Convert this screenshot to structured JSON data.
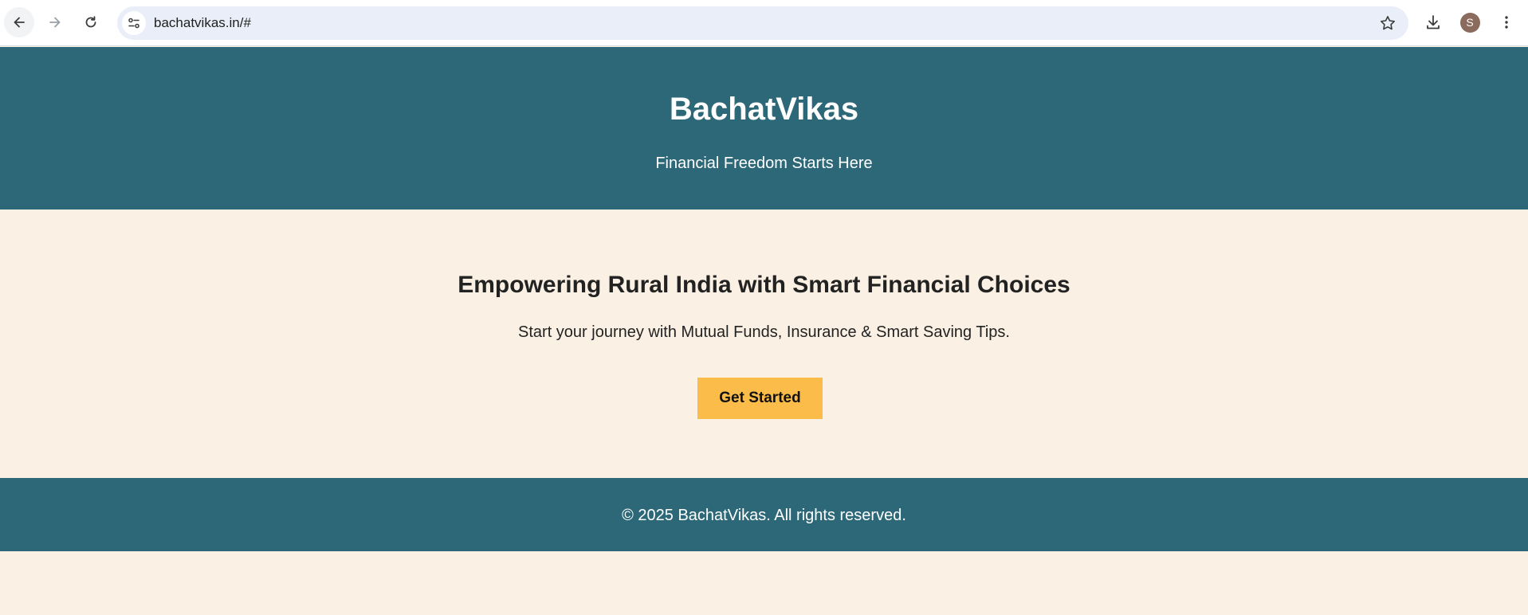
{
  "browser": {
    "url": "bachatvikas.in/#",
    "profile_initial": "S",
    "icons": {
      "back": "arrow-left-icon",
      "forward": "arrow-right-icon",
      "reload": "reload-icon",
      "site_info": "tune-icon",
      "bookmark": "star-icon",
      "download": "download-icon",
      "menu": "kebab-menu-icon"
    }
  },
  "header": {
    "title": "BachatVikas",
    "tagline": "Financial Freedom Starts Here"
  },
  "hero": {
    "heading": "Empowering Rural India with Smart Financial Choices",
    "subtext": "Start your journey with Mutual Funds, Insurance & Smart Saving Tips.",
    "cta_label": "Get Started"
  },
  "footer": {
    "copyright": "© 2025 BachatVikas. All rights reserved."
  },
  "colors": {
    "header_bg": "#2d6878",
    "page_bg": "#faf1e4",
    "cta_bg": "#fcbc49",
    "omnibox_bg": "#e9eef8"
  }
}
